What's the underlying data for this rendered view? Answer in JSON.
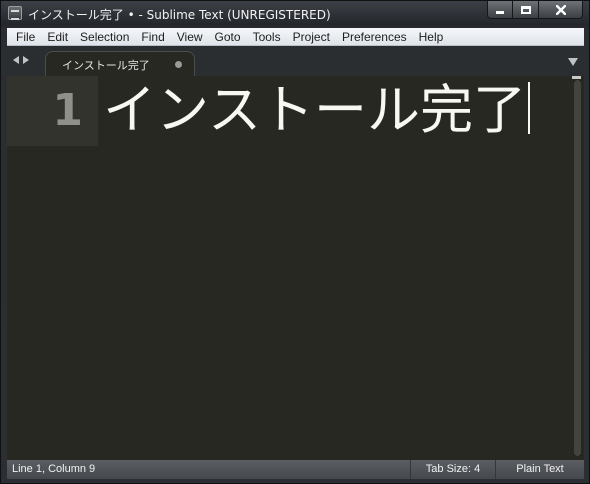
{
  "window": {
    "title": "インストール完了 • - Sublime Text (UNREGISTERED)"
  },
  "menu": {
    "items": [
      "File",
      "Edit",
      "Selection",
      "Find",
      "View",
      "Goto",
      "Tools",
      "Project",
      "Preferences",
      "Help"
    ]
  },
  "tabs": [
    {
      "label": "インストール完了",
      "modified": true
    }
  ],
  "editor": {
    "lines": [
      {
        "number": "1",
        "text": "インストール完了"
      }
    ]
  },
  "status": {
    "position": "Line 1, Column 9",
    "tab_size": "Tab Size: 4",
    "syntax": "Plain Text"
  },
  "colors": {
    "editor_background": "#272822",
    "text": "#f8f8f2",
    "gutter_highlight": "#32332d",
    "line_number": "#8f908a"
  }
}
